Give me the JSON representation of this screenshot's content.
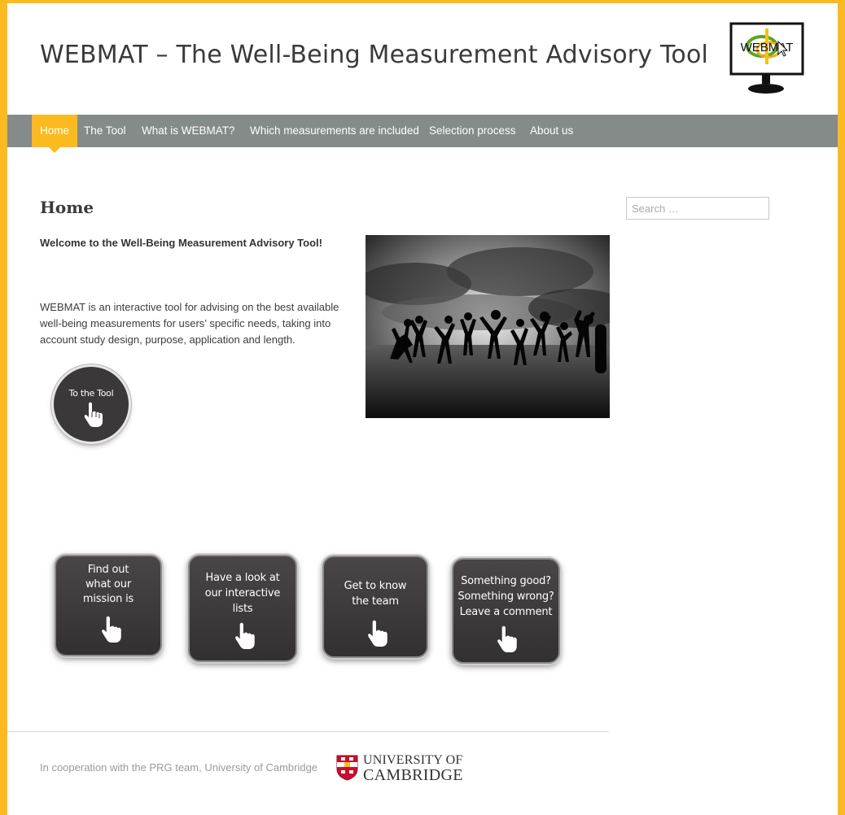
{
  "header": {
    "site_title": "WEBMAT – The Well-Being Measurement Advisory Tool",
    "logo_text": "WEBMAT"
  },
  "nav": {
    "items": [
      {
        "label": "Home",
        "active": true
      },
      {
        "label": "The Tool",
        "active": false
      },
      {
        "label": "What is WEBMAT?",
        "active": false
      },
      {
        "label": "Which measurements are included",
        "active": false
      },
      {
        "label": "Selection process",
        "active": false
      },
      {
        "label": "About us",
        "active": false
      }
    ]
  },
  "main": {
    "heading": "Home",
    "welcome": "Welcome to the Well-Being Measurement Advisory Tool!",
    "intro": "WEBMAT is an interactive tool for advising on the best available well-being measurements for users’ specific needs, taking into account study design, purpose, application and length.",
    "hero_image": "silhouettes-jumping-on-beach-photo",
    "tool_button": "To the Tool",
    "tiles": [
      {
        "lines": [
          "Find out",
          "what our",
          "mission is"
        ]
      },
      {
        "lines": [
          "Have a look at",
          "our interactive",
          "lists"
        ]
      },
      {
        "lines": [
          "Get to know",
          "the team"
        ]
      },
      {
        "lines": [
          "Something good?",
          "Something wrong?",
          "Leave a comment"
        ]
      }
    ]
  },
  "sidebar": {
    "search_placeholder": "Search …"
  },
  "footer": {
    "cooperation_text": "In cooperation with the PRG team, University of Cambridge",
    "university_line1": "UNIVERSITY OF",
    "university_line2": "CAMBRIDGE"
  },
  "colors": {
    "accent": "#fbba1f",
    "nav_background": "#848b89",
    "button_dark": "#3b3839"
  }
}
